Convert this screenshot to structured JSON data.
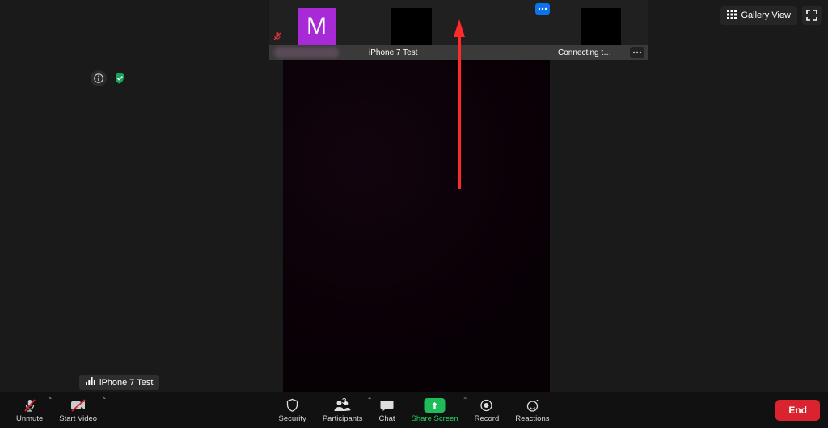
{
  "top": {
    "gallery_label": "Gallery View"
  },
  "participants_strip": [
    {
      "avatar_letter": "M",
      "name": "",
      "muted": true
    },
    {
      "name": "iPhone 7 Test"
    },
    {
      "name": ""
    },
    {
      "name": "Connecting t…"
    }
  ],
  "audio_tooltip": {
    "label": "iPhone 7 Test"
  },
  "toolbar": {
    "unmute": "Unmute",
    "start_video": "Start Video",
    "security": "Security",
    "participants": "Participants",
    "participants_count": "3",
    "chat": "Chat",
    "share_screen": "Share Screen",
    "record": "Record",
    "reactions": "Reactions",
    "end": "End"
  },
  "colors": {
    "accent_purple": "#a829d6",
    "accent_blue": "#0e72ed",
    "share_green": "#1fbd5a",
    "end_red": "#d9232e",
    "arrow_red": "#ff2a2a"
  }
}
